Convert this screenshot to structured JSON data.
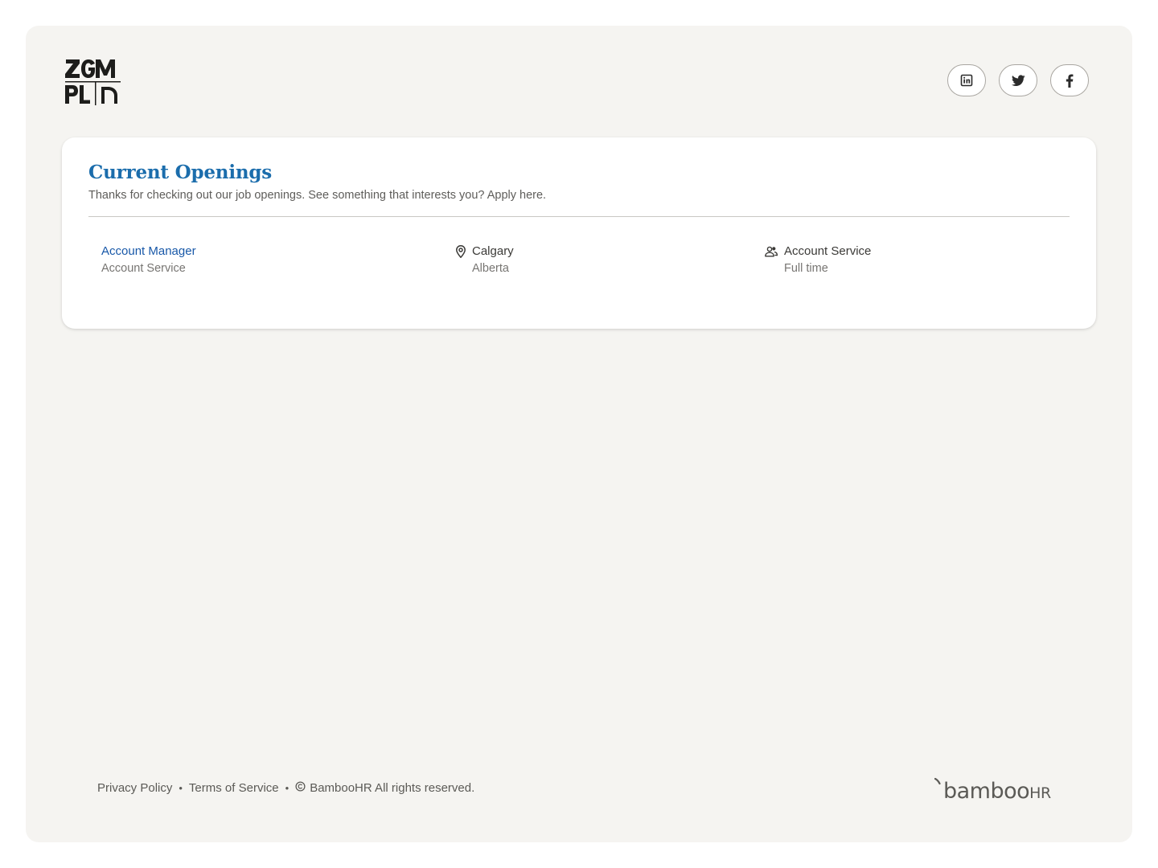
{
  "brand": {
    "logo_lines": [
      "ZGM",
      "PL D"
    ],
    "alt": "ZGM PLD"
  },
  "socials": [
    {
      "name": "linkedin",
      "icon": "linkedin-icon"
    },
    {
      "name": "twitter",
      "icon": "twitter-icon"
    },
    {
      "name": "facebook",
      "icon": "facebook-icon"
    }
  ],
  "openings": {
    "title": "Current Openings",
    "subtitle": "Thanks for checking out our job openings. See something that interests you? Apply here.",
    "jobs": [
      {
        "title": "Account Manager",
        "department": "Account Service",
        "city": "Calgary",
        "region": "Alberta",
        "team": "Account Service",
        "employment_type": "Full time"
      }
    ]
  },
  "footer": {
    "privacy": "Privacy Policy",
    "terms": "Terms of Service",
    "copyright": "BambooHR All rights reserved.",
    "separator": "•",
    "powered_by": "bambooHR"
  },
  "colors": {
    "page_bg": "#f5f4f1",
    "title_blue": "#1b6dac",
    "link_blue": "#1858a8",
    "muted_text": "#777572"
  }
}
